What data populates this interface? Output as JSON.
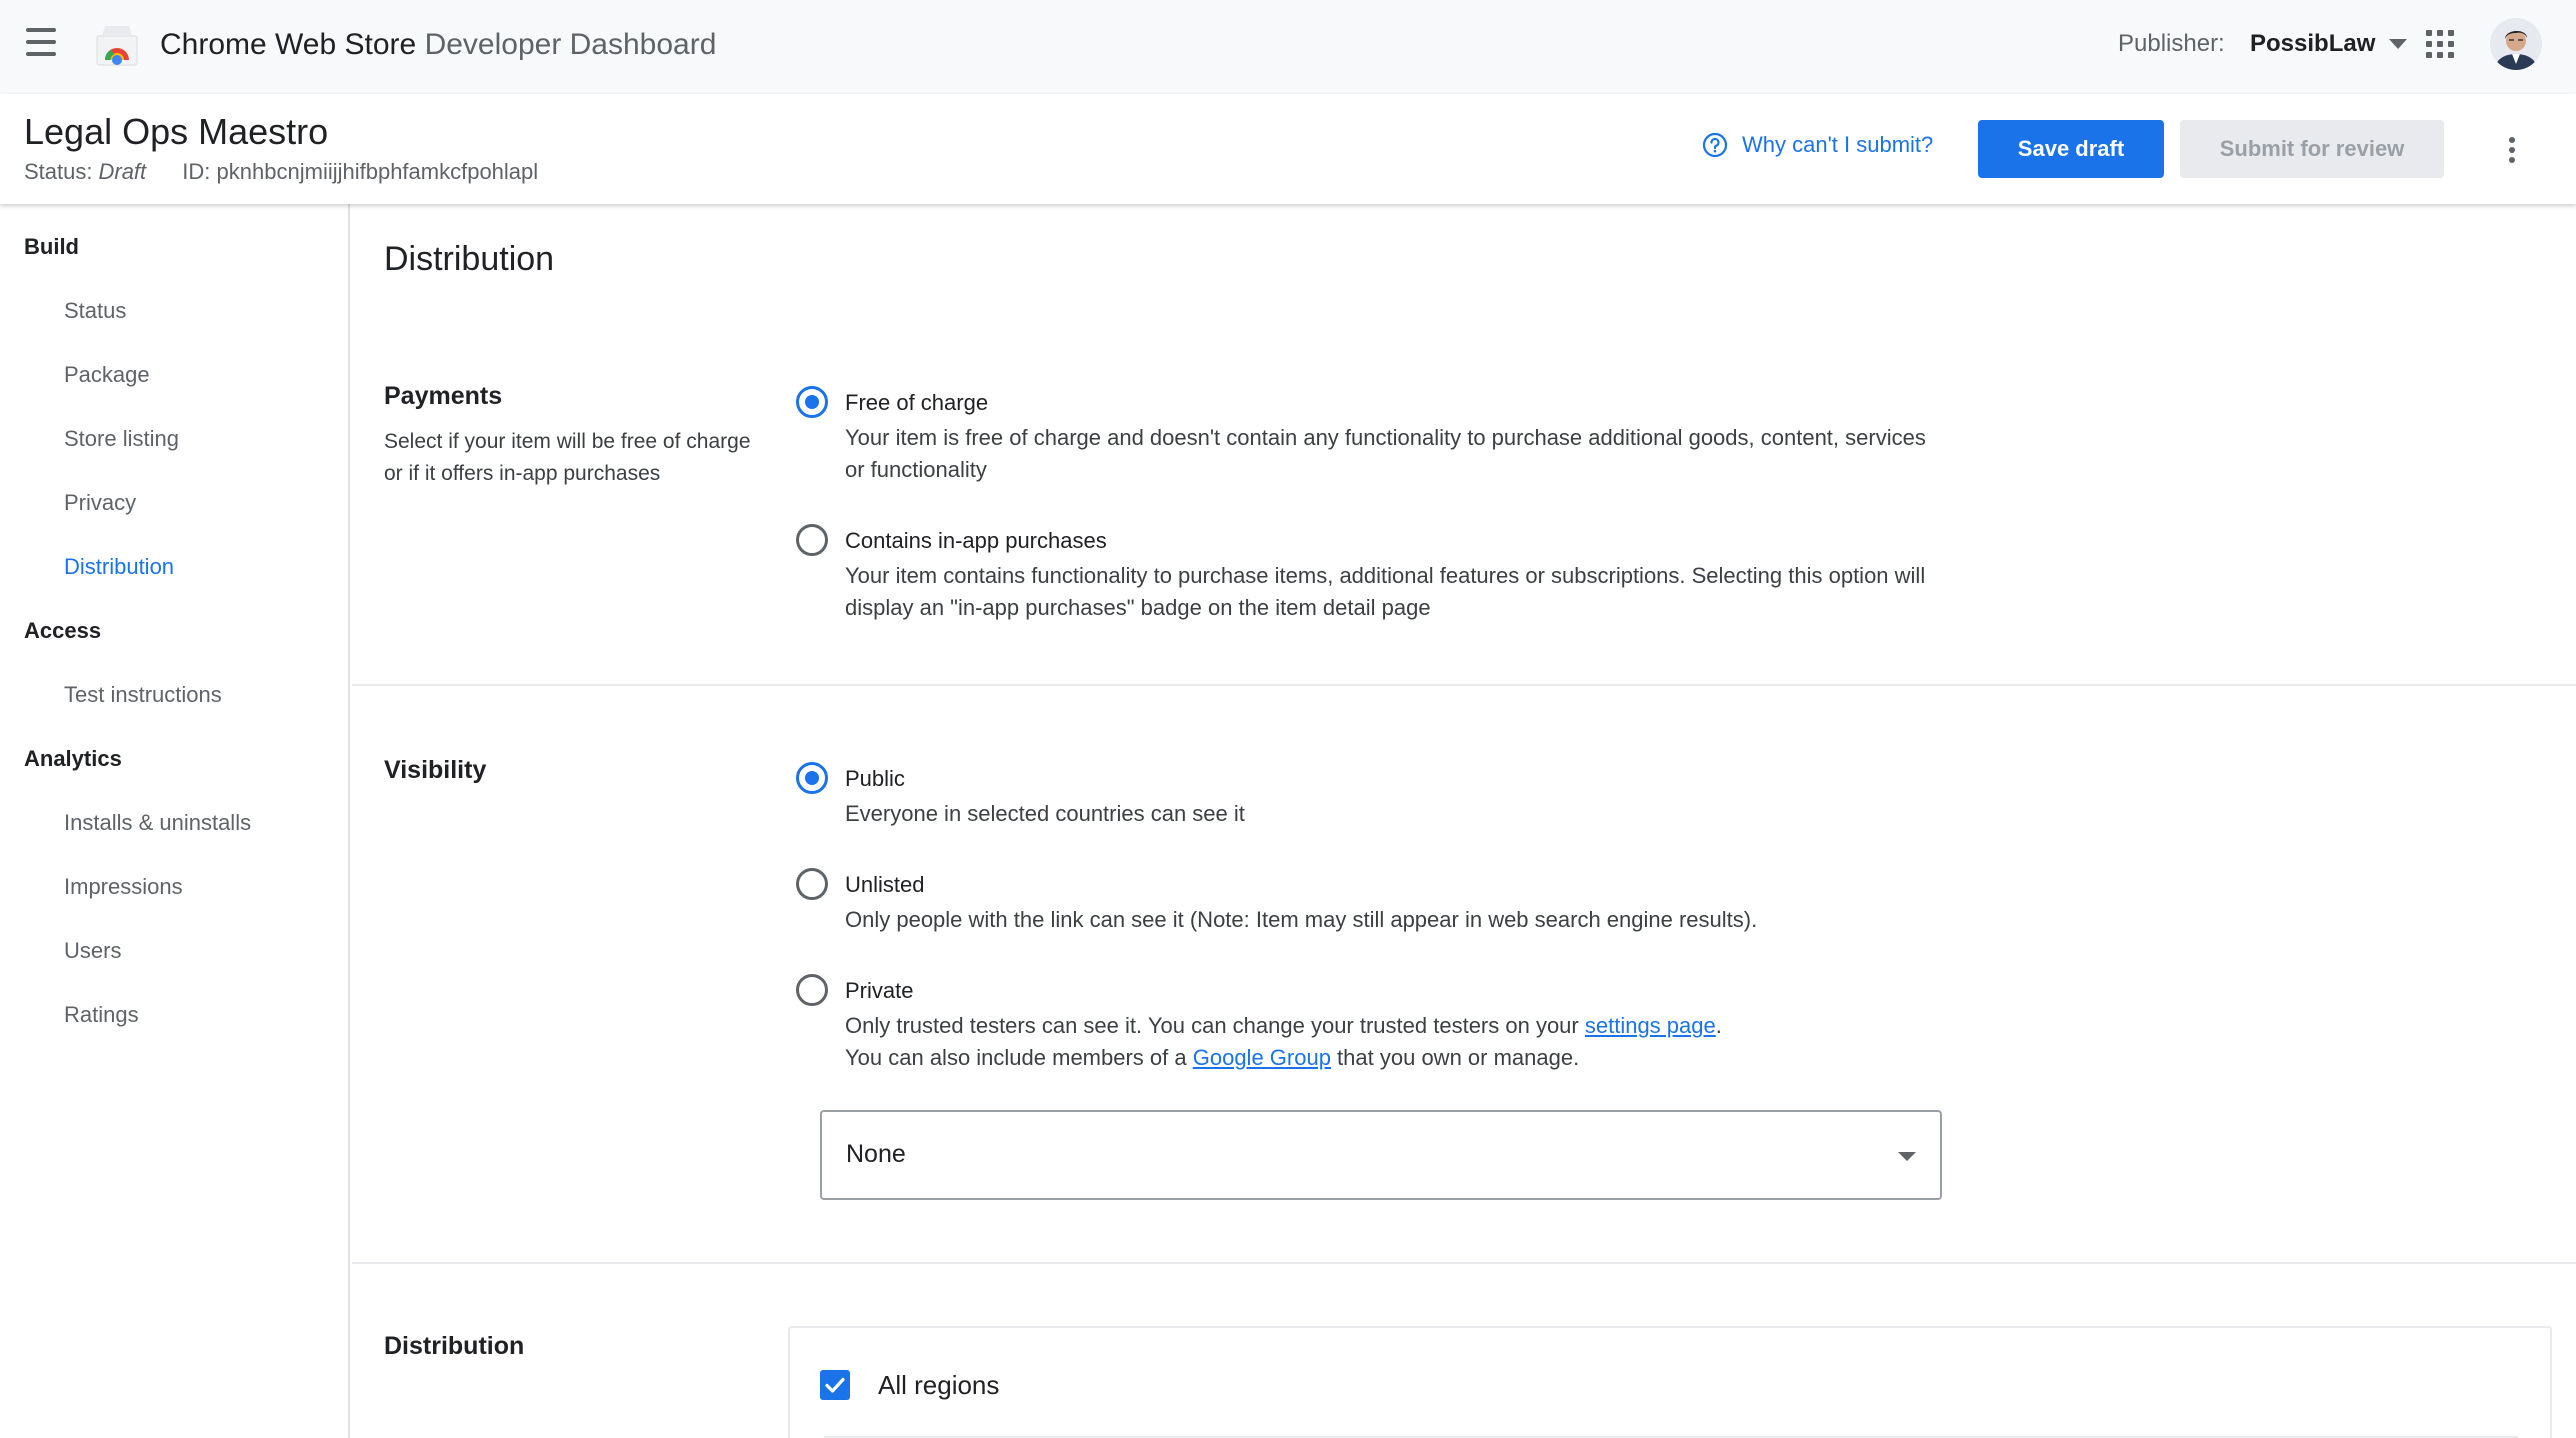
{
  "topbar": {
    "app_title_strong": "Chrome Web Store",
    "app_title_light": "Developer Dashboard",
    "publisher_label": "Publisher:",
    "publisher_name": "PossibLaw"
  },
  "item": {
    "name": "Legal Ops Maestro",
    "status_label": "Status:",
    "status_value": "Draft",
    "id_label": "ID:",
    "id_value": "pknhbcnjmiijjhifbphfamkcfpohlapl",
    "help_link": "Why can't I submit?",
    "save_label": "Save draft",
    "submit_label": "Submit for review"
  },
  "sidebar": {
    "build": "Build",
    "build_items": [
      "Status",
      "Package",
      "Store listing",
      "Privacy",
      "Distribution"
    ],
    "access": "Access",
    "access_items": [
      "Test instructions"
    ],
    "analytics": "Analytics",
    "analytics_items": [
      "Installs & uninstalls",
      "Impressions",
      "Users",
      "Ratings"
    ],
    "active_item": "Distribution"
  },
  "main": {
    "page_title": "Distribution",
    "payments": {
      "title": "Payments",
      "description": "Select if your item will be free of charge or if it offers in-app purchases",
      "options": [
        {
          "label": "Free of charge",
          "description": "Your item is free of charge and doesn't contain any functionality to purchase additional goods, content, services or functionality",
          "selected": true
        },
        {
          "label": "Contains in-app purchases",
          "description": "Your item contains functionality to purchase items, additional features or subscriptions. Selecting this option will display an \"in-app purchases\" badge on the item detail page",
          "selected": false
        }
      ]
    },
    "visibility": {
      "title": "Visibility",
      "options": [
        {
          "label": "Public",
          "description": "Everyone in selected countries can see it",
          "selected": true
        },
        {
          "label": "Unlisted",
          "description": "Only people with the link can see it (Note: Item may still appear in web search engine results).",
          "selected": false
        },
        {
          "label": "Private",
          "selected": false,
          "desc_part1": "Only trusted testers can see it. You can change your trusted testers on your ",
          "desc_link1": "settings page",
          "desc_part2": ".",
          "desc_part3": "You can also include members of a ",
          "desc_link2": "Google Group",
          "desc_part4": " that you own or manage."
        }
      ],
      "group_select_value": "None"
    },
    "distribution": {
      "title": "Distribution",
      "all_regions_label": "All regions",
      "all_regions_checked": true
    }
  },
  "colors": {
    "accent": "#1a73e8",
    "topbar_bg": "#f8f9fa",
    "disabled_bg": "#e8eaed"
  },
  "icons": [
    "menu-icon",
    "chrome-web-store-logo",
    "caret-down-icon",
    "apps-grid-icon",
    "help-circle-icon",
    "more-vert-icon",
    "dropdown-arrow-icon",
    "check-icon"
  ]
}
